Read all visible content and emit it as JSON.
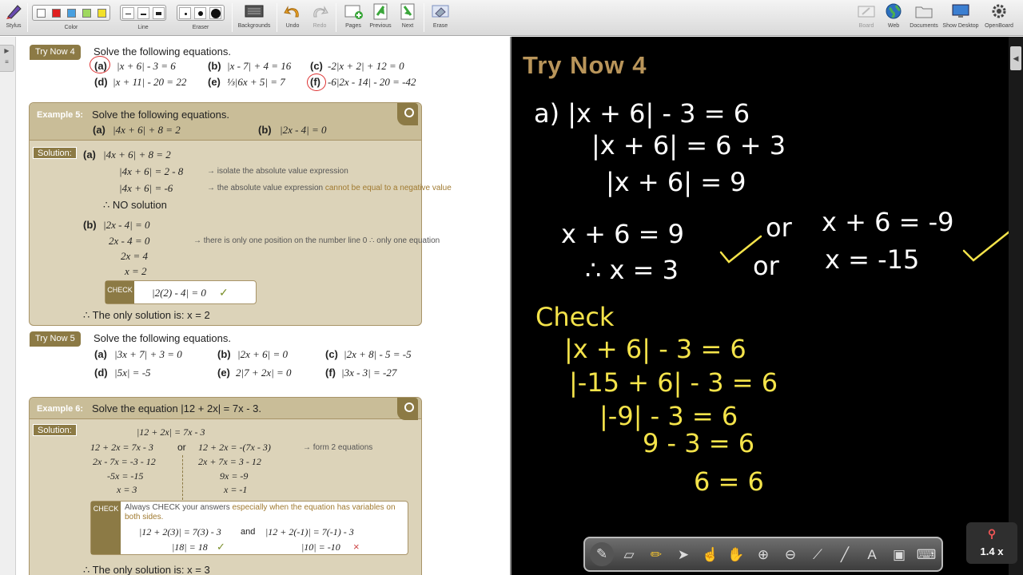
{
  "toolbar": {
    "stylus": "Stylus",
    "color": "Color",
    "colors": [
      "#ffffff",
      "#e02020",
      "#48a0e0",
      "#9fd860",
      "#f2e02a"
    ],
    "line": "Line",
    "eraser": "Eraser",
    "backgrounds": "Backgrounds",
    "undo": "Undo",
    "redo": "Redo",
    "pages": "Pages",
    "previous": "Previous",
    "next": "Next",
    "erase": "Erase",
    "board": "Board",
    "web": "Web",
    "documents": "Documents",
    "show_desktop": "Show Desktop",
    "openboard": "OpenBoard"
  },
  "doc": {
    "try4": {
      "pill": "Try Now 4",
      "title": "Solve the following equations.",
      "a_lab": "(a)",
      "a": "|x + 6| - 3 = 6",
      "b_lab": "(b)",
      "b": "|x - 7| + 4 = 16",
      "c_lab": "(c)",
      "c": "-2|x + 2| + 12 = 0",
      "d_lab": "(d)",
      "d": "|x + 11| - 20 = 22",
      "e_lab": "(e)",
      "e": "⅓|6x + 5| = 7",
      "f_lab": "(f)",
      "f": "-6|2x - 14| - 20 = -42"
    },
    "ex5": {
      "label": "Example 5:",
      "title": "Solve the following equations.",
      "a_lab": "(a)",
      "a": "|4x + 6| + 8 = 2",
      "b_lab": "(b)",
      "b": "|2x - 4| = 0",
      "solution": "Solution:",
      "sa1": "|4x + 6| + 8 = 2",
      "sa2": "|4x + 6| = 2 - 8",
      "sa2_note": "→ isolate the absolute value expression",
      "sa3": "|4x + 6| = -6",
      "sa3_note": "→ the absolute value expression",
      "sa3_warn": "cannot be equal to a negative value",
      "sa4": "∴  NO solution",
      "sb1": "|2x - 4| = 0",
      "sb2": "2x - 4 = 0",
      "sb2_note": "→ there is only one position on the number line 0  ∴  only one equation",
      "sb3": "2x = 4",
      "sb4": "x = 2",
      "check_tag": "CHECK",
      "check": "|2(2) - 4| = 0",
      "tick": "✓",
      "conclusion": "∴   The only solution is:  x = 2"
    },
    "try5": {
      "pill": "Try Now 5",
      "title": "Solve the following equations.",
      "a_lab": "(a)",
      "a": "|3x + 7| + 3 = 0",
      "b_lab": "(b)",
      "b": "|2x + 6| = 0",
      "c_lab": "(c)",
      "c": "|2x + 8| - 5 = -5",
      "d_lab": "(d)",
      "d": "|5x| = -5",
      "e_lab": "(e)",
      "e": "2|7 + 2x| = 0",
      "f_lab": "(f)",
      "f": "|3x - 3| = -27"
    },
    "ex6": {
      "label": "Example 6:",
      "title": "Solve the equation  |12 + 2x| = 7x - 3.",
      "solution": "Solution:",
      "s0": "|12 + 2x| = 7x - 3",
      "l1": "12 + 2x = 7x - 3",
      "or": "or",
      "r1": "12 + 2x = -(7x - 3)",
      "note": "→ form 2 equations",
      "l2": "2x - 7x = -3 - 12",
      "r2": "2x + 7x = 3 - 12",
      "l3": "-5x = -15",
      "r3": "9x = -9",
      "l4": "x = 3",
      "r4": "x = -1",
      "check_tag": "CHECK",
      "check_note1": "Always CHECK your answers",
      "check_note2": "especially when the equation has variables on",
      "check_note3": "both sides.",
      "c1": "|12 + 2(3)| = 7(3) - 3",
      "and": "and",
      "c2": "|12 + 2(-1)| = 7(-1) - 3",
      "c3": "|18| = 18",
      "tick": "✓",
      "c4": "|10| = -10",
      "cross": "×",
      "conclusion": "∴   The only solution is:  x = 3"
    }
  },
  "board": {
    "title": "Try Now 4",
    "ink": {
      "w1": "a)  |x + 6| - 3 = 6",
      "w2": "|x + 6| = 6 + 3",
      "w3": "|x + 6| = 9",
      "w4a": "x + 6 = 9",
      "w4b": "or",
      "w4c": "x + 6 = -9",
      "w5a": "∴ x = 3",
      "w5b": "or",
      "w5c": "x = -15",
      "y1": "Check",
      "y2": "|x + 6| - 3 = 6",
      "y3": "|-15 + 6| - 3 = 6",
      "y4": "|-9| - 3 = 6",
      "y5": "9 - 3 = 6",
      "y6": "6 = 6"
    },
    "colors": {
      "white": "#ffffff",
      "yellow": "#f4e34a",
      "title": "#b9955a"
    }
  },
  "zoom": "1.4 x"
}
